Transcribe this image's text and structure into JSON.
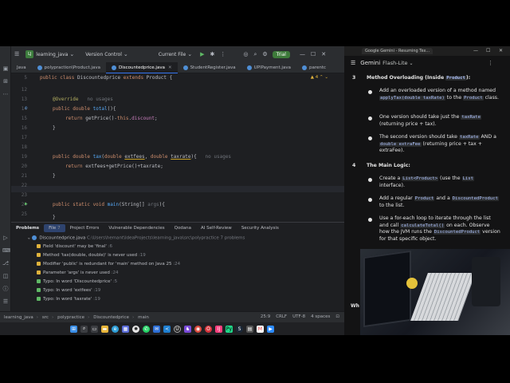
{
  "ide": {
    "project_badge": "LJ",
    "project_name": "learning_java",
    "vcs": "Version Control",
    "run_config": "Current File",
    "trial": "Trial",
    "tabs": [
      {
        "label": "Java"
      },
      {
        "label": "polypraction\\Product.java"
      },
      {
        "label": "Discountedprice.java",
        "active": true
      },
      {
        "label": "StudentRegister.java"
      },
      {
        "label": "UPIPayment.java"
      },
      {
        "label": "parentc"
      }
    ],
    "editor": {
      "warning_count": "4",
      "lines": [
        {
          "n": "5",
          "text": "public class Discountedprice extends Product {"
        },
        {
          "n": "12",
          "text": ""
        },
        {
          "n": "13",
          "annotation": "@Override",
          "hint": "no usages"
        },
        {
          "n": "14",
          "text": "public double total(){"
        },
        {
          "n": "15",
          "text": "return getPrice()-this.discount;"
        },
        {
          "n": "16",
          "text": "}"
        },
        {
          "n": "17",
          "text": ""
        },
        {
          "n": "18",
          "text": ""
        },
        {
          "n": "19",
          "text": "public double tax(double extfees, double taxrate){",
          "hint": "no usages"
        },
        {
          "n": "20",
          "text": "return extfees+getPrice()+taxrate;"
        },
        {
          "n": "21",
          "text": "}"
        },
        {
          "n": "22",
          "text": ""
        },
        {
          "n": "23",
          "text": ""
        },
        {
          "n": "24",
          "text": "public static void main(String[] args){"
        },
        {
          "n": "25",
          "text": ""
        },
        {
          "n": "26",
          "text": "}"
        }
      ]
    },
    "problems": {
      "title": "Problems",
      "tabs": [
        {
          "label": "File",
          "count": "7"
        },
        {
          "label": "Project Errors"
        },
        {
          "label": "Vulnerable Dependencies"
        },
        {
          "label": "Qodana"
        },
        {
          "label": "AI Self-Review"
        },
        {
          "label": "Security Analysis"
        }
      ],
      "file_entry": {
        "name": "Discountedprice.java",
        "path": "C:\\Users\\hemant\\IdeaProjects\\learning_java\\src\\polypractice",
        "count": "7 problems"
      },
      "items": [
        {
          "kind": "warn",
          "text": "Field 'discount' may be 'final'",
          "line": ":6"
        },
        {
          "kind": "warn",
          "text": "Method 'tax(double, double)' is never used",
          "line": ":19"
        },
        {
          "kind": "warn",
          "text": "Modifier 'public' is redundant for 'main' method on Java 25",
          "line": ":24"
        },
        {
          "kind": "warn",
          "text": "Parameter 'args' is never used",
          "line": ":24"
        },
        {
          "kind": "typo",
          "text": "Typo: In word 'Discountedprice'",
          "line": ":5"
        },
        {
          "kind": "typo",
          "text": "Typo: In word 'extfees'",
          "line": ":19"
        },
        {
          "kind": "typo",
          "text": "Typo: In word 'taxrate'",
          "line": ":19"
        }
      ]
    },
    "status": {
      "breadcrumbs": [
        "learning_java",
        "src",
        "polypractice",
        "Discountedprice",
        "main"
      ],
      "position": "25:9",
      "line_sep": "CRLF",
      "encoding": "UTF-8",
      "indent": "4 spaces"
    }
  },
  "browser": {
    "tab_title": "Google Gemini - Resuming Tex...",
    "gemini_title": "Gemini",
    "model": "Flash-Lite",
    "sections": [
      {
        "num": "3",
        "title": "Method Overloading (Inside ",
        "title_code": "Product",
        "title_end": "):"
      },
      {
        "num": "4",
        "title": "The Main Logic:"
      }
    ],
    "bullets3": [
      {
        "parts": [
          {
            "t": "Add an overloaded version of a method named "
          },
          {
            "c": "applyTax(double taxRate)"
          },
          {
            "t": " to the "
          },
          {
            "c": "Product"
          },
          {
            "t": " class."
          }
        ]
      },
      {
        "parts": [
          {
            "t": "One version should take just the "
          },
          {
            "c": "taxRate"
          },
          {
            "t": " (returning price + tax)."
          }
        ]
      },
      {
        "parts": [
          {
            "t": "The second version should take "
          },
          {
            "c": "taxRate"
          },
          {
            "t": " AND a "
          },
          {
            "c": "double extraFee"
          },
          {
            "t": " (returning price + tax + extraFee)."
          }
        ]
      }
    ],
    "bullets4": [
      {
        "parts": [
          {
            "t": "Create a "
          },
          {
            "c": "List<Product>"
          },
          {
            "t": " (use the "
          },
          {
            "c": "List"
          },
          {
            "t": " interface)."
          }
        ]
      },
      {
        "parts": [
          {
            "t": "Add a regular "
          },
          {
            "c": "Product"
          },
          {
            "t": " and a "
          },
          {
            "c": "DiscountedProduct"
          },
          {
            "t": " to the list."
          }
        ]
      },
      {
        "parts": [
          {
            "t": "Use a for-each loop to iterate through the list and call "
          },
          {
            "c": "calculateTotal()"
          },
          {
            "t": " on each. Observe how the JVM runs the "
          },
          {
            "c": "DiscountedProduct"
          },
          {
            "t": " version for that specific object."
          }
        ]
      }
    ],
    "partial_text": "Wh"
  },
  "colors": {
    "accent": "#3574f0",
    "trial": "#3d7a3a",
    "warning": "#e0b33c",
    "keyword": "#cf8e6d",
    "function": "#56a8f5"
  }
}
